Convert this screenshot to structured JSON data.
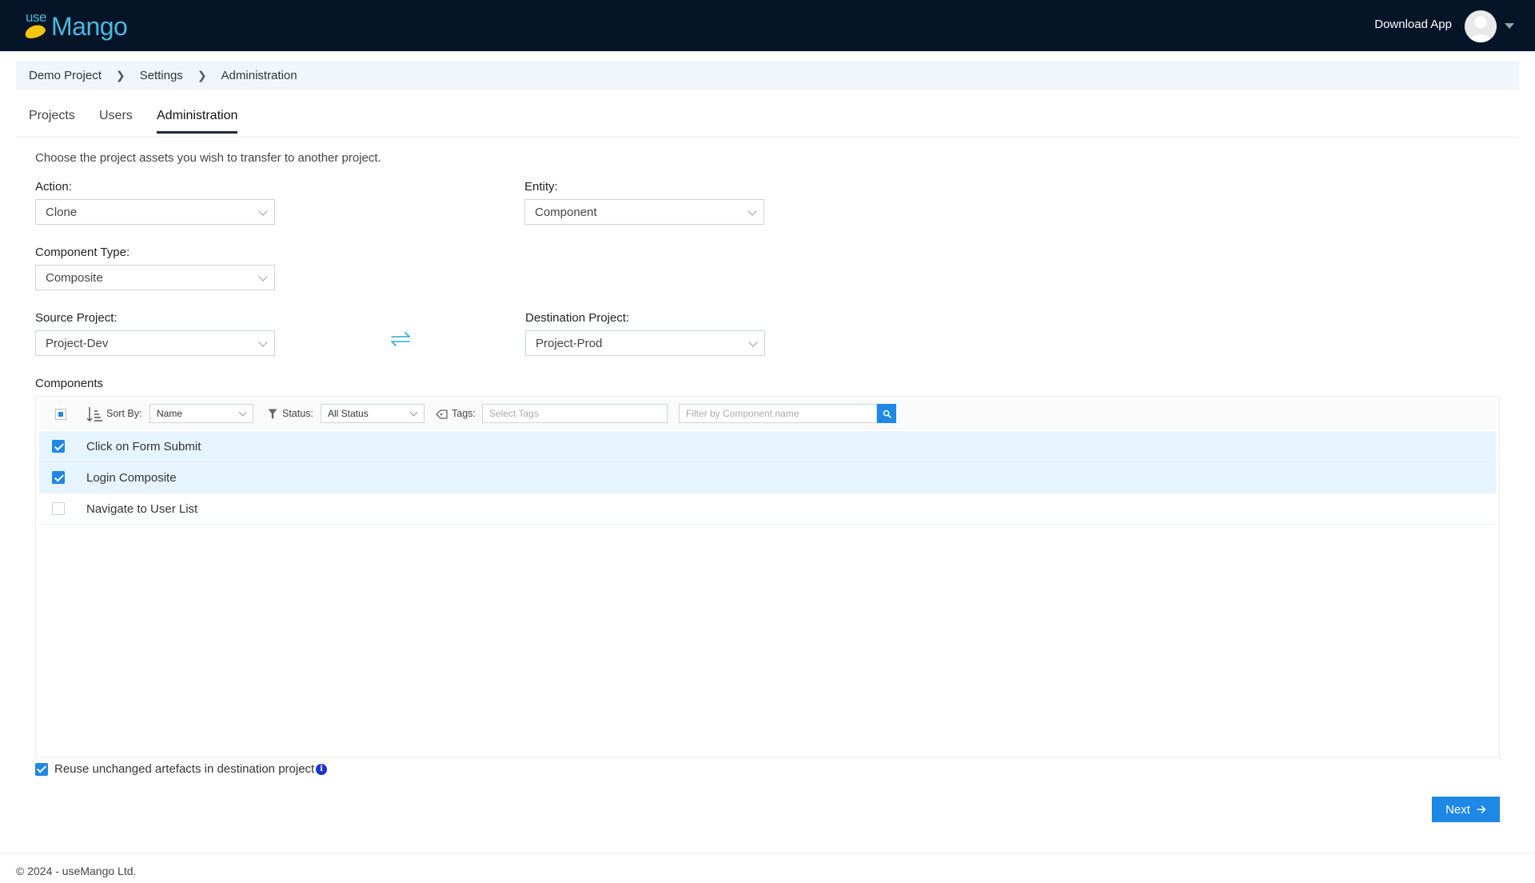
{
  "header": {
    "logo_text_use": "use",
    "logo_text_mango": "Mango",
    "download_app": "Download App"
  },
  "breadcrumb": [
    "Demo Project",
    "Settings",
    "Administration"
  ],
  "tabs": [
    {
      "label": "Projects",
      "active": false
    },
    {
      "label": "Users",
      "active": false
    },
    {
      "label": "Administration",
      "active": true
    }
  ],
  "form": {
    "intro": "Choose the project assets you wish to transfer to another project.",
    "action": {
      "label": "Action:",
      "value": "Clone"
    },
    "entity": {
      "label": "Entity:",
      "value": "Component"
    },
    "component_type": {
      "label": "Component Type:",
      "value": "Composite"
    },
    "source_project": {
      "label": "Source Project:",
      "value": "Project-Dev"
    },
    "destination_project": {
      "label": "Destination Project:",
      "value": "Project-Prod"
    }
  },
  "components": {
    "label": "Components",
    "toolbar": {
      "sort_by_label": "Sort By:",
      "sort_by_value": "Name",
      "status_label": "Status:",
      "status_value": "All Status",
      "tags_label": "Tags:",
      "tags_placeholder": "Select Tags",
      "filter_placeholder": "Filter by Component name"
    },
    "items": [
      {
        "name": "Click on Form Submit",
        "checked": true
      },
      {
        "name": "Login Composite",
        "checked": true
      },
      {
        "name": "Navigate to User List",
        "checked": false
      }
    ]
  },
  "reuse": {
    "label": "Reuse unchanged artefacts in destination project",
    "checked": true,
    "info_glyph": "i"
  },
  "next_label": "Next",
  "footer": "© 2024 - useMango Ltd.",
  "colors": {
    "topbar": "#061428",
    "accent": "#1e88e5",
    "selected_row": "#e6f4fd",
    "info": "#1a33d4"
  },
  "icons": [
    "logo-icon",
    "avatar-icon",
    "chevron-right-icon",
    "chevron-down-icon",
    "swap-arrows-icon",
    "sort-icon",
    "filter-icon",
    "tag-icon",
    "search-icon",
    "info-icon",
    "arrow-right-icon",
    "checkbox-check-icon"
  ]
}
